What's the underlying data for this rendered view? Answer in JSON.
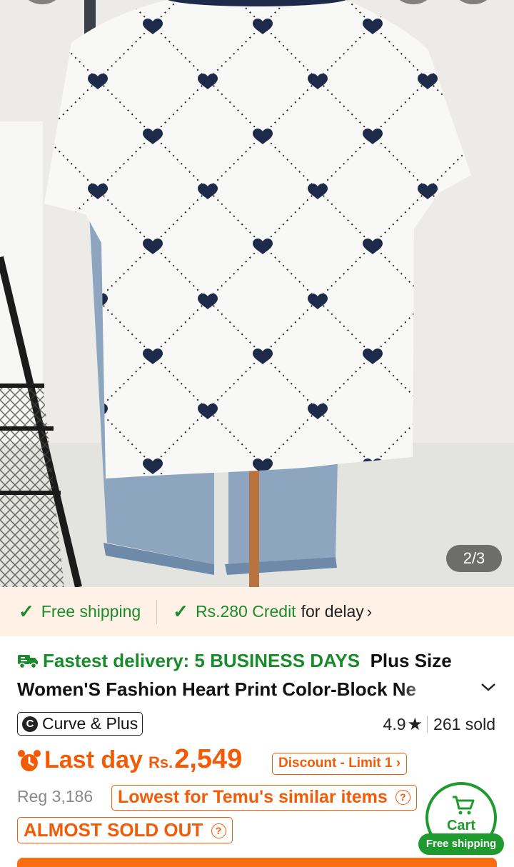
{
  "gallery": {
    "counter": "2/3",
    "image_alt": "White heart print t-shirt on mannequin with jeans"
  },
  "shipping_strip": {
    "free_shipping": "Free shipping",
    "credit_amount": "Rs.280 Credit",
    "credit_suffix": "for delay",
    "chevron": "›"
  },
  "title": {
    "fastest_delivery": "Fastest delivery: 5 BUSINESS DAYS",
    "product_name": "Plus Size Women'S Fashion Heart Print Color-Block Ne"
  },
  "brand": {
    "logo_letter": "C",
    "name": "Curve & Plus"
  },
  "rating": {
    "score": "4.9",
    "sold": "261 sold"
  },
  "price": {
    "last_day": "Last day",
    "currency": "Rs.",
    "amount": "2,549",
    "discount_label": "Discount - Limit 1",
    "discount_chevron": "›"
  },
  "regular": {
    "label": "Reg 3,186"
  },
  "badges": {
    "lowest": "Lowest for Temu's similar items",
    "sold_out": "ALMOST SOLD OUT",
    "question": "?"
  },
  "cart": {
    "label": "Cart",
    "free_shipping": "Free shipping"
  },
  "colors": {
    "accent_orange": "#f35b06",
    "green": "#1a8b2b",
    "cart_green": "#1f9a2e",
    "strip_bg": "#fff1e6"
  }
}
